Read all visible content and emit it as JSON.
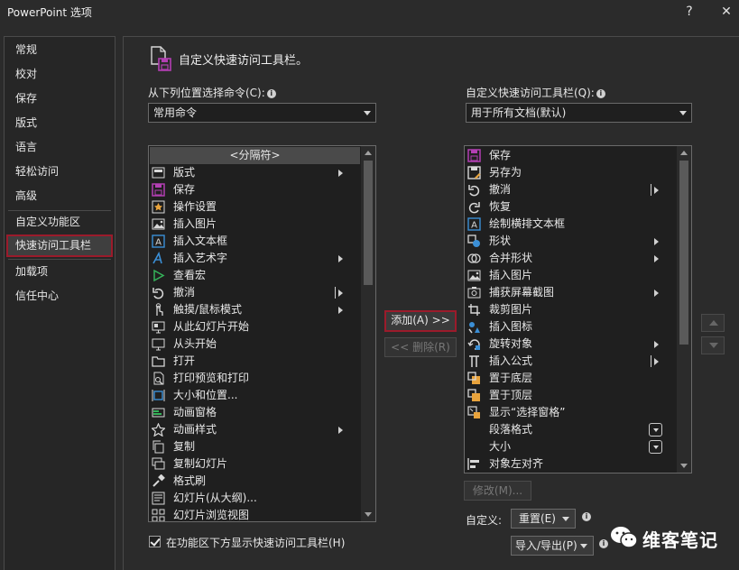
{
  "window": {
    "title": "PowerPoint 选项",
    "help": "?",
    "close": "✕"
  },
  "nav": {
    "items": [
      {
        "label": "常规"
      },
      {
        "label": "校对"
      },
      {
        "label": "保存"
      },
      {
        "label": "版式"
      },
      {
        "label": "语言"
      },
      {
        "label": "轻松访问"
      },
      {
        "label": "高级"
      },
      {
        "label": "自定义功能区"
      },
      {
        "label": "快速访问工具栏",
        "selected": true
      },
      {
        "label": "加载项"
      },
      {
        "label": "信任中心"
      }
    ]
  },
  "header": {
    "title": "自定义快速访问工具栏。"
  },
  "left": {
    "label": "从下列位置选择命令(C):",
    "combo_value": "常用命令",
    "items": [
      {
        "label": "<分隔符>",
        "icon": "separator",
        "kind": "separator"
      },
      {
        "label": "版式",
        "icon": "layout-icon",
        "sub": "arrow"
      },
      {
        "label": "保存",
        "icon": "save-icon"
      },
      {
        "label": "操作设置",
        "icon": "action-settings-icon"
      },
      {
        "label": "插入图片",
        "icon": "picture-icon"
      },
      {
        "label": "插入文本框",
        "icon": "textbox-icon"
      },
      {
        "label": "插入艺术字",
        "icon": "wordart-icon",
        "sub": "arrow"
      },
      {
        "label": "查看宏",
        "icon": "macro-icon"
      },
      {
        "label": "撤消",
        "icon": "undo-icon",
        "sub": "split"
      },
      {
        "label": "触摸/鼠标模式",
        "icon": "touch-icon",
        "sub": "arrow"
      },
      {
        "label": "从此幻灯片开始",
        "icon": "present-current-icon"
      },
      {
        "label": "从头开始",
        "icon": "present-start-icon"
      },
      {
        "label": "打开",
        "icon": "open-icon"
      },
      {
        "label": "打印预览和打印",
        "icon": "print-preview-icon"
      },
      {
        "label": "大小和位置...",
        "icon": "size-position-icon"
      },
      {
        "label": "动画窗格",
        "icon": "animation-pane-icon"
      },
      {
        "label": "动画样式",
        "icon": "animation-style-icon",
        "sub": "arrow"
      },
      {
        "label": "复制",
        "icon": "copy-icon"
      },
      {
        "label": "复制幻灯片",
        "icon": "duplicate-slide-icon"
      },
      {
        "label": "格式刷",
        "icon": "format-painter-icon"
      },
      {
        "label": "幻灯片(从大纲)...",
        "icon": "slides-from-outline-icon"
      },
      {
        "label": "幻灯片浏览视图",
        "icon": "slide-sorter-icon"
      }
    ]
  },
  "right": {
    "label": "自定义快速访问工具栏(Q):",
    "combo_value": "用于所有文档(默认)",
    "items": [
      {
        "label": "保存",
        "icon": "save-icon"
      },
      {
        "label": "另存为",
        "icon": "save-as-icon"
      },
      {
        "label": "撤消",
        "icon": "undo-icon",
        "sub": "split"
      },
      {
        "label": "恢复",
        "icon": "redo-icon"
      },
      {
        "label": "绘制横排文本框",
        "icon": "draw-textbox-icon"
      },
      {
        "label": "形状",
        "icon": "shapes-icon",
        "sub": "arrow"
      },
      {
        "label": "合并形状",
        "icon": "merge-shapes-icon",
        "sub": "arrow"
      },
      {
        "label": "插入图片",
        "icon": "picture-icon"
      },
      {
        "label": "捕获屏幕截图",
        "icon": "screenshot-icon",
        "sub": "arrow"
      },
      {
        "label": "裁剪图片",
        "icon": "crop-icon"
      },
      {
        "label": "插入图标",
        "icon": "icons-icon"
      },
      {
        "label": "旋转对象",
        "icon": "rotate-icon",
        "sub": "arrow"
      },
      {
        "label": "插入公式",
        "icon": "equation-icon",
        "sub": "split"
      },
      {
        "label": "置于底层",
        "icon": "send-back-icon"
      },
      {
        "label": "置于顶层",
        "icon": "bring-front-icon"
      },
      {
        "label": "显示“选择窗格”",
        "icon": "selection-pane-icon"
      },
      {
        "label": "段落格式",
        "icon": "none",
        "sub": "dropdown"
      },
      {
        "label": "大小",
        "icon": "none",
        "sub": "dropdown"
      },
      {
        "label": "对象左对齐",
        "icon": "align-left-icon"
      }
    ]
  },
  "buttons": {
    "add": "添加(A) >>",
    "remove": "<< 删除(R)",
    "modify": "修改(M)...",
    "reset": "重置(E)",
    "import_export": "导入/导出(P)"
  },
  "customize_label": "自定义:",
  "show_below_ribbon": {
    "label": "在功能区下方显示快速访问工具栏(H)",
    "checked": true
  },
  "watermark": {
    "text": "维客笔记"
  },
  "colors": {
    "accent": "#9b1b2b",
    "save": "#b33fb3",
    "blue": "#3b8fd6"
  }
}
